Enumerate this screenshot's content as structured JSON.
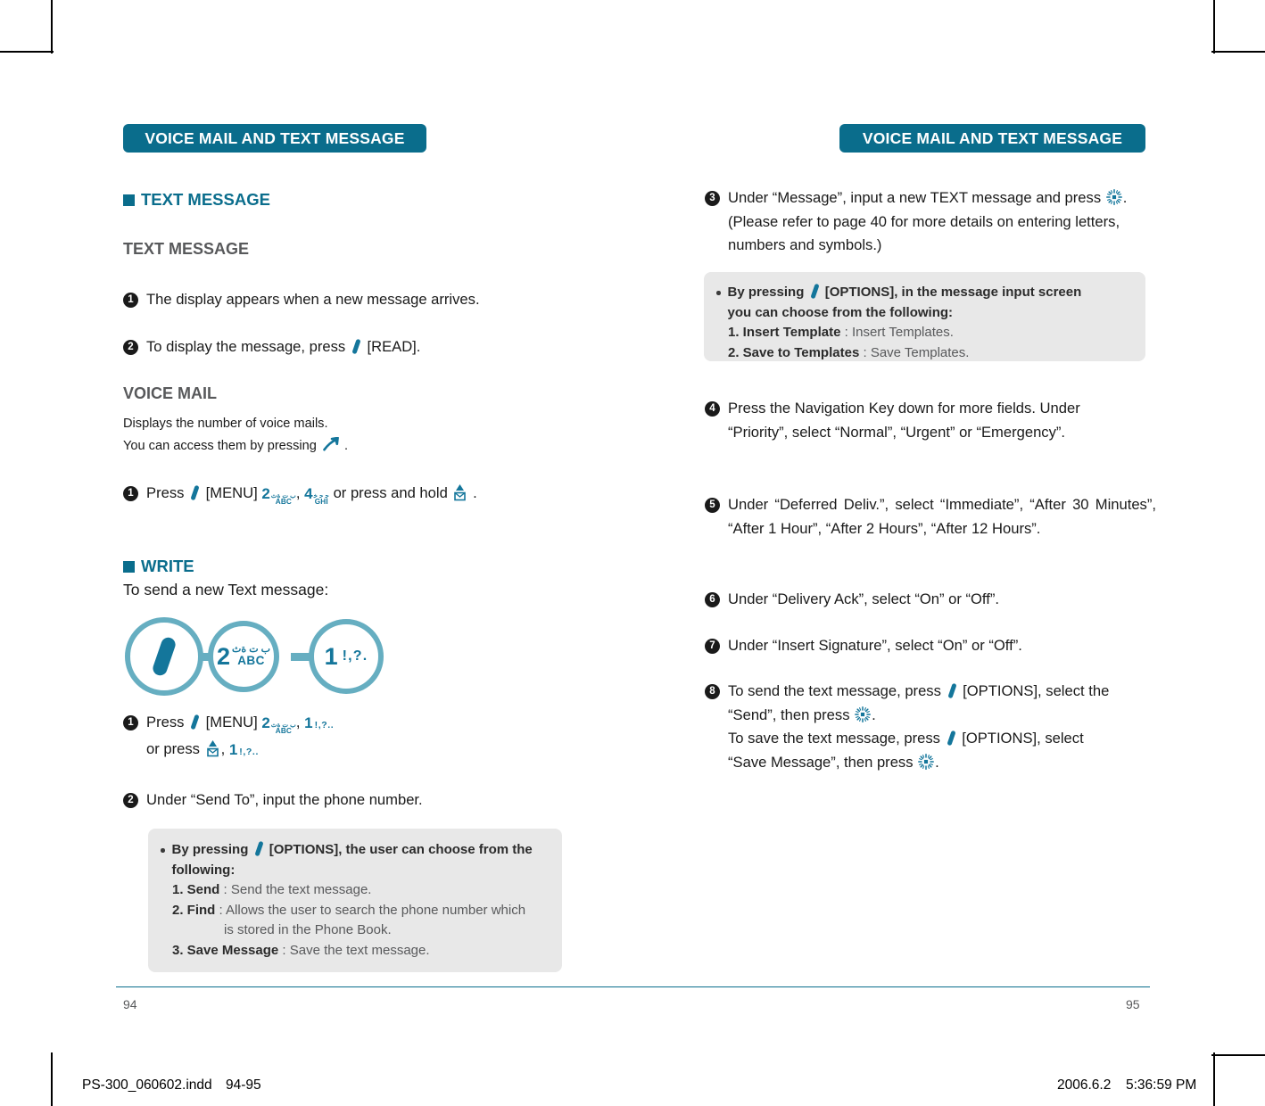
{
  "document": {
    "running_head_left": "VOICE MAIL AND TEXT MESSAGE",
    "running_head_right": "VOICE MAIL AND TEXT MESSAGE",
    "folio_left": "94",
    "folio_right": "95"
  },
  "imposition": {
    "file_name": "PS-300_060602.indd",
    "page_range": "94-95",
    "date": "2006.6.2",
    "time": "5:36:59 PM"
  },
  "left_page": {
    "section_title": "TEXT MESSAGE",
    "subsection_title": "TEXT MESSAGE",
    "step1": {
      "num": "1",
      "text": "The display appears when a new message arrives."
    },
    "step2": {
      "num": "2",
      "before": "To display the message, press",
      "after": "[READ]."
    },
    "voice_mail": {
      "title": "VOICE MAIL",
      "line1": "Displays the number of voice mails.",
      "line2_before": "You can access them by pressing",
      "line2_after": ".",
      "step1": {
        "num": "1",
        "press": "Press",
        "menu": "[MENU]",
        "key2_digit": "2",
        "key2_arabic": "ب ت ةث",
        "key2_latin": "ABC",
        "comma": ",",
        "key4_digit": "4",
        "key4_arabic": "ﺟ ﺣ ﺧ",
        "key4_latin": "GHI",
        "tail": "or press and hold",
        "period": "."
      }
    },
    "write": {
      "section_title": "WRITE",
      "intro": "To send a new Text message:",
      "flow": {
        "node1_icon": "softkey-slash-icon",
        "node2_digit": "2",
        "node2_arabic": "ب ت ةث",
        "node2_latin": "ABC",
        "node3_digit": "1",
        "node3_punct": "!,?."
      },
      "step1": {
        "num": "1",
        "press": "Press",
        "menu": "[MENU]",
        "key2_digit": "2",
        "key2_arabic": "ب ت ةث",
        "key2_latin": "ABC",
        "comma": ",",
        "key1_digit": "1",
        "key1_punct": "!,?..",
        "line2_before": "or press",
        "line2_comma": ",",
        "line2_key_digit": "1",
        "line2_key_punct": "!,?.."
      },
      "step2": {
        "num": "2",
        "text": "Under “Send To”, input the phone number."
      },
      "note": {
        "head_before": "By pressing",
        "head_after": "[OPTIONS], the user can choose from the following:",
        "items": [
          {
            "label": "1. Send",
            "sep": " : ",
            "desc": "Send the text message.",
            "cont": ""
          },
          {
            "label": "2. Find",
            "sep": " : ",
            "desc": "Allows the user to search the phone number which",
            "cont": "is stored in the Phone Book."
          },
          {
            "label": "3. Save Message",
            "sep": " : ",
            "desc": "Save the text message.",
            "cont": ""
          }
        ]
      }
    }
  },
  "right_page": {
    "step3": {
      "num": "3",
      "part1": "Under “Message”, input a new TEXT message and press",
      "part2": ". (Please refer to page 40 for more details on entering letters, numbers and symbols.)"
    },
    "note3": {
      "head_before": "By pressing",
      "head_after": "[OPTIONS], in the message input screen you can choose from the following:",
      "items": [
        {
          "label": "1. Insert Template",
          "sep": " : ",
          "desc": "Insert Templates."
        },
        {
          "label": "2. Save to Templates",
          "sep": " : ",
          "desc": "Save Templates."
        }
      ]
    },
    "step4": {
      "num": "4",
      "text": "Press the Navigation Key down for more fields. Under “Priority”, select “Normal”, “Urgent” or “Emergency”."
    },
    "step5": {
      "num": "5",
      "text": "Under “Deferred Deliv.”, select “Immediate”, “After 30 Minutes”, “After 1 Hour”, “After 2 Hours”, “After 12 Hours”."
    },
    "step6": {
      "num": "6",
      "text": "Under “Delivery Ack”, select “On” or “Off”."
    },
    "step7": {
      "num": "7",
      "text": "Under “Insert Signature”, select “On” or “Off”."
    },
    "step8": {
      "num": "8",
      "l1_before": "To send the text message, press",
      "l1_after": "[OPTIONS], select the",
      "l2_before": "“Send”, then press",
      "l2_after": ".",
      "l3_before": "To save the text message, press",
      "l3_after": "[OPTIONS], select",
      "l4_before": "“Save Message”, then press",
      "l4_after": "."
    }
  },
  "colors": {
    "teal_head": "#0a6d8c",
    "teal_glyph": "#14769b",
    "teal_light": "#66aec1",
    "note_bg": "#e8e8e8",
    "gray_text": "#58595b"
  }
}
